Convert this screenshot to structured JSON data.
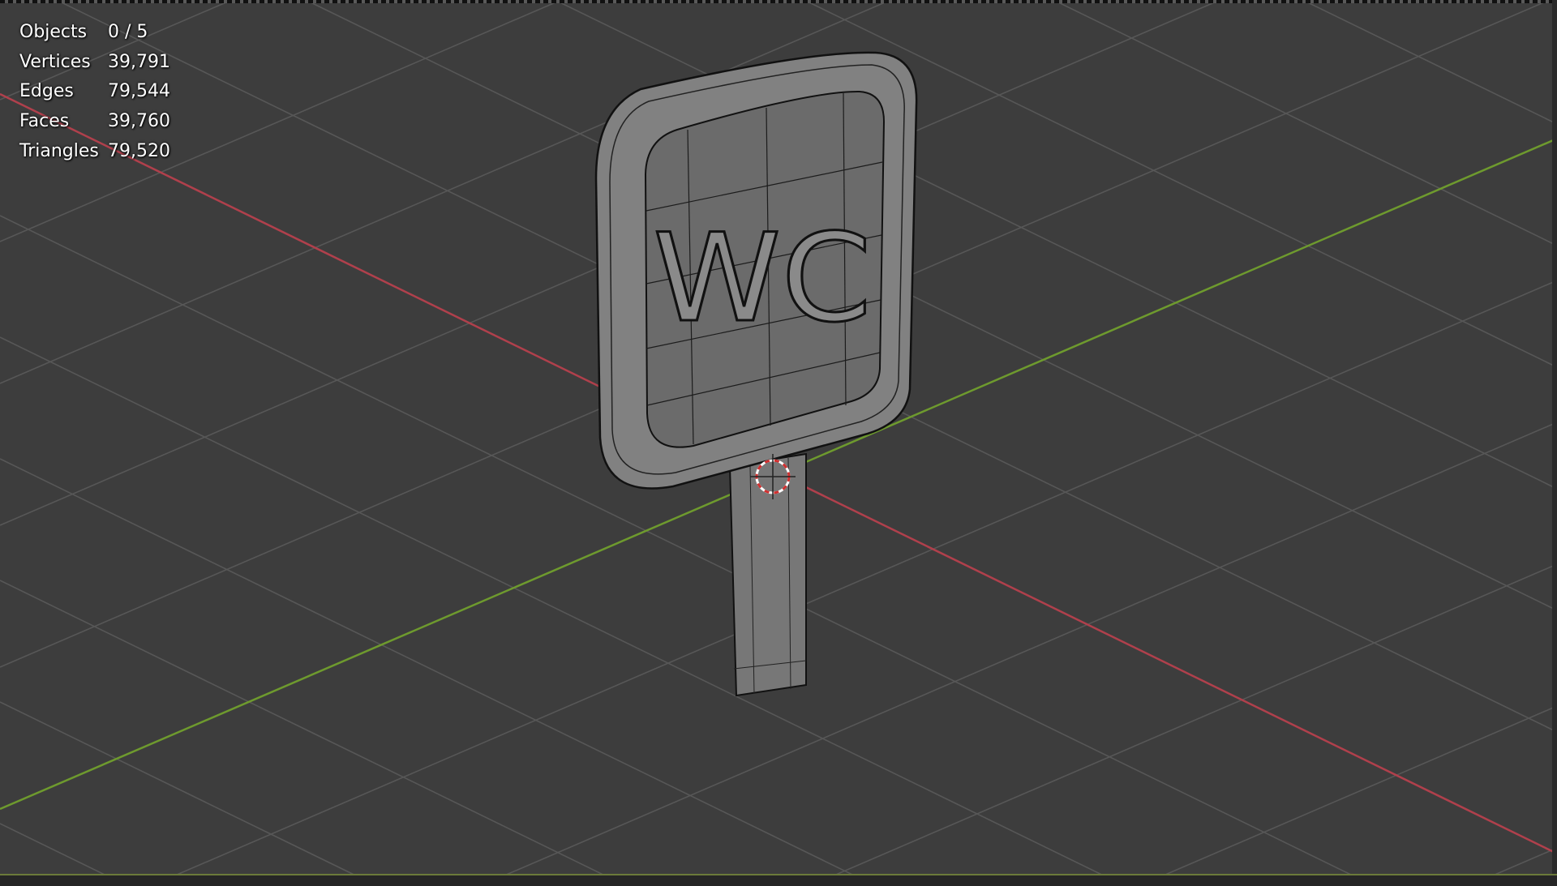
{
  "viewport": {
    "statistics": [
      {
        "label": "Objects",
        "value": "0 / 5"
      },
      {
        "label": "Vertices",
        "value": "39,791"
      },
      {
        "label": "Edges",
        "value": "79,544"
      },
      {
        "label": "Faces",
        "value": "39,760"
      },
      {
        "label": "Triangles",
        "value": "79,520"
      }
    ],
    "sign_text": "WC",
    "colors": {
      "background": "#3d3d3d",
      "grid": "#565656",
      "x_axis": "#b0404c",
      "y_axis": "#6e9a2e",
      "mesh": "#7a7a7a"
    }
  }
}
